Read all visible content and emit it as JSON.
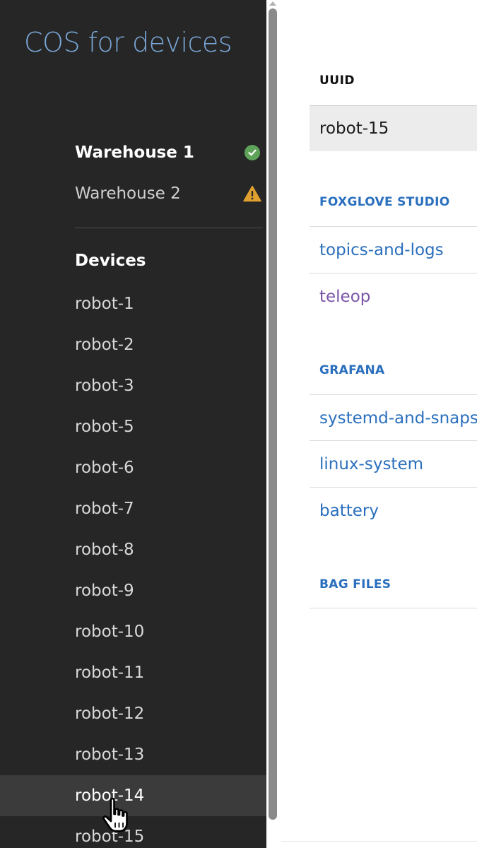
{
  "app": {
    "title": "COS for devices"
  },
  "sidebar": {
    "warehouses": [
      {
        "label": "Warehouse 1",
        "status": "ok",
        "active": true
      },
      {
        "label": "Warehouse 2",
        "status": "warning",
        "active": false
      }
    ],
    "devices_heading": "Devices",
    "devices": [
      "robot-1",
      "robot-2",
      "robot-3",
      "robot-5",
      "robot-6",
      "robot-7",
      "robot-8",
      "robot-9",
      "robot-10",
      "robot-11",
      "robot-12",
      "robot-13",
      "robot-14",
      "robot-15"
    ],
    "hovered_device": "robot-14"
  },
  "main": {
    "uuid_label": "UUID",
    "uuid_value": "robot-15",
    "foxglove": {
      "title": "FOXGLOVE STUDIO",
      "links": [
        "topics-and-logs",
        "teleop"
      ]
    },
    "grafana": {
      "title": "GRAFANA",
      "links": [
        "systemd-and-snaps",
        "linux-system",
        "battery"
      ]
    },
    "bag_files": {
      "title": "BAG FILES"
    }
  },
  "colors": {
    "sidebar_bg": "#262626",
    "title": "#7aa7d6",
    "link": "#2a6fbd",
    "visited_link": "#7a55a6",
    "ok": "#5fa35a",
    "warning": "#e0a030"
  }
}
